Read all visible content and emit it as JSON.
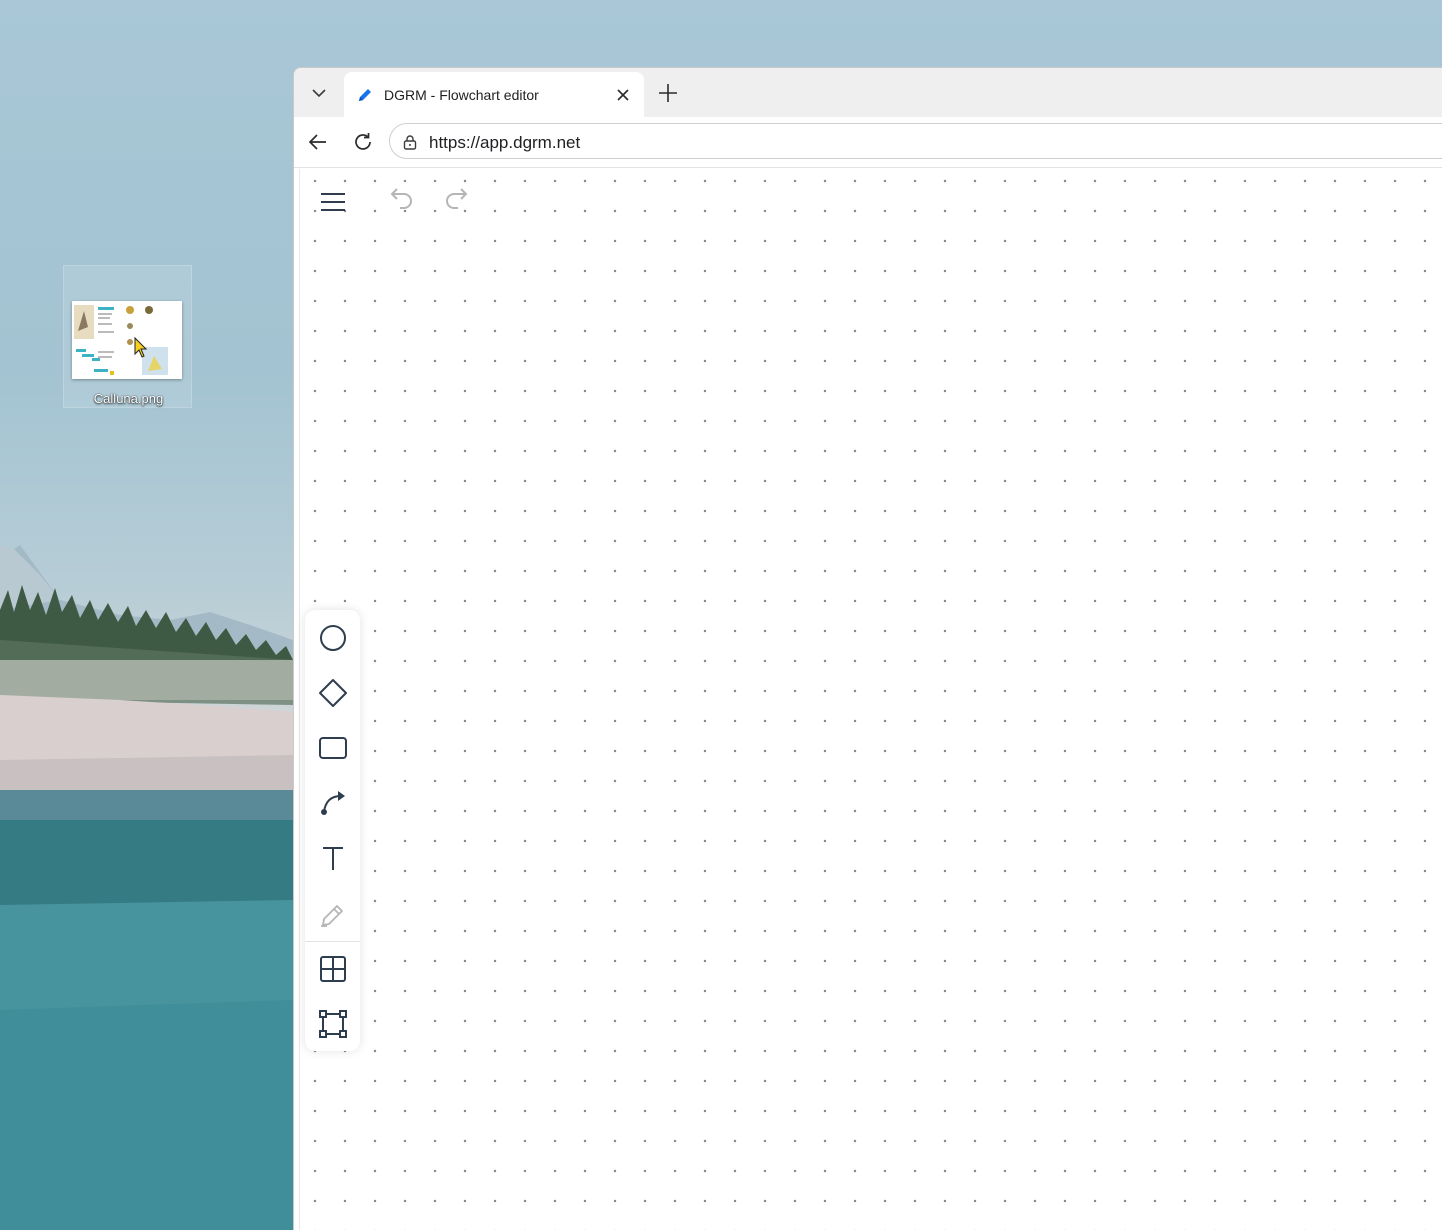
{
  "desktop": {
    "file_icon": {
      "label": "Calluna.png",
      "icon": "image-file-icon"
    }
  },
  "browser": {
    "tab": {
      "title": "DGRM - Flowchart editor",
      "favicon": "pencil-icon"
    },
    "address": {
      "url": "https://app.dgrm.net"
    }
  },
  "app": {
    "top_controls": [
      "menu-icon",
      "undo-icon",
      "redo-icon"
    ],
    "toolbar": {
      "tools": [
        "circle-icon",
        "diamond-icon",
        "rectangle-icon",
        "connector-icon",
        "text-icon",
        "pen-icon",
        "table-icon",
        "frame-icon"
      ]
    }
  },
  "colors": {
    "icon": "#2f3e4e",
    "icon_disabled": "#b5b5b5",
    "favicon": "#1a73e8"
  }
}
